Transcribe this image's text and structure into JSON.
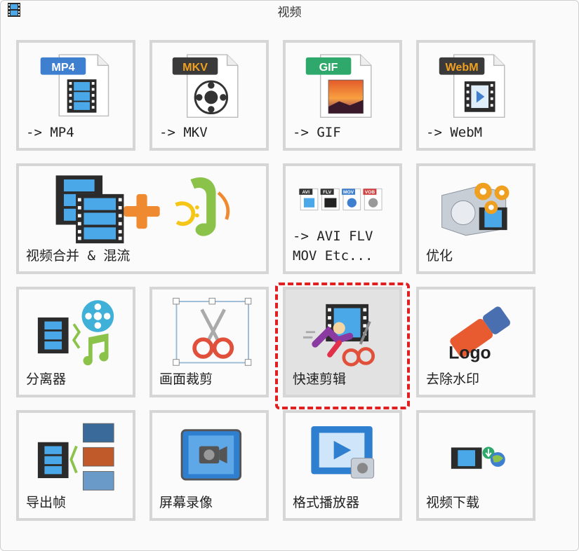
{
  "window": {
    "title": "视频",
    "icon": "film-strip-icon"
  },
  "tiles": [
    {
      "id": "mp4",
      "label": "-> MP4",
      "badge": "MP4",
      "badge_color": "#3f7fd0",
      "icon": "mp4-file-icon"
    },
    {
      "id": "mkv",
      "label": "-> MKV",
      "badge": "MKV",
      "badge_color": "#3a3a3a",
      "icon": "mkv-file-icon"
    },
    {
      "id": "gif",
      "label": "-> GIF",
      "badge": "GIF",
      "badge_color": "#2fa86b",
      "icon": "gif-file-icon"
    },
    {
      "id": "webm",
      "label": "-> WebM",
      "badge": "WebM",
      "badge_color": "#3a3a3a",
      "icon": "webm-file-icon"
    },
    {
      "id": "merge",
      "label": "视频合并 & 混流",
      "icon": "merge-video-music-icon"
    },
    {
      "id": "avi",
      "label": "-> AVI FLV\nMOV Etc...",
      "icon": "multi-format-icon",
      "mini_badges": [
        "AVI",
        "FLV",
        "MOV",
        "VOB"
      ]
    },
    {
      "id": "optimize",
      "label": "优化",
      "icon": "optimize-gears-icon"
    },
    {
      "id": "splitter",
      "label": "分离器",
      "icon": "splitter-icon"
    },
    {
      "id": "crop",
      "label": "画面裁剪",
      "icon": "crop-scissors-icon"
    },
    {
      "id": "quickcut",
      "label": "快速剪辑",
      "icon": "quick-cut-icon",
      "selected": true
    },
    {
      "id": "watermark",
      "label": "去除水印",
      "icon": "eraser-logo-icon",
      "logo_text": "Logo"
    },
    {
      "id": "frames",
      "label": "导出帧",
      "icon": "export-frames-icon"
    },
    {
      "id": "record",
      "label": "屏幕录像",
      "icon": "screen-record-icon"
    },
    {
      "id": "player",
      "label": "格式播放器",
      "icon": "format-player-icon"
    },
    {
      "id": "download",
      "label": "视频下载",
      "icon": "video-download-icon"
    }
  ],
  "colors": {
    "selection": "#e02020",
    "tile_border": "#d6d6d6",
    "film": "#2b2b2b",
    "film_frame": "#4aa8e8"
  }
}
